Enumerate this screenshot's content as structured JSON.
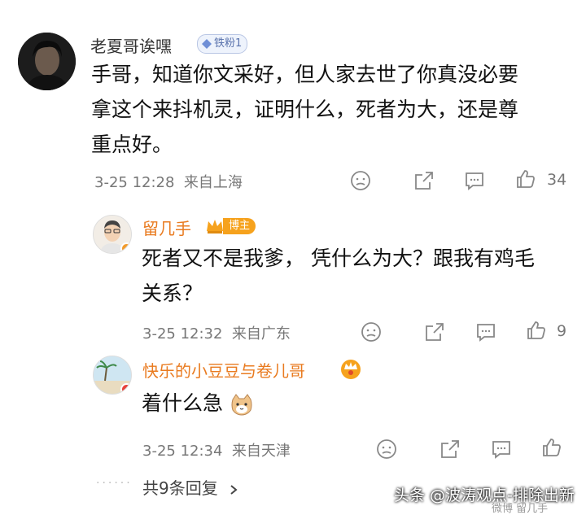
{
  "main_comment": {
    "username": "老夏哥诶嘿",
    "fan_badge": "铁粉1",
    "text_lines": [
      "手哥，知道你文采好，但人家去世了你真没必要",
      "拿这个来抖机灵，证明什么，死者为大，还是尊",
      "重点好。"
    ],
    "time": "3-25 12:28",
    "location": "来自上海",
    "like_count": "34"
  },
  "reply1": {
    "username": "留几手",
    "host_badge": "博主",
    "text_lines": [
      "死者又不是我爹， 凭什么为大？跟我有鸡毛",
      "关系？"
    ],
    "time": "3-25 12:32",
    "location": "来自广东",
    "like_count": "9"
  },
  "reply2": {
    "username": "快乐的小豆豆与卷儿哥",
    "text": "着什么急",
    "time": "3-25 12:34",
    "location": "来自天津"
  },
  "more_replies": "共9条回复",
  "watermark": "头条 @波涛观点-排除出新",
  "watermark_small": "微博 留几手",
  "icons": [
    "dislike-icon",
    "share-icon",
    "comment-icon",
    "like-icon",
    "chevron-right-icon",
    "cat-emoji-icon",
    "crown-icon"
  ]
}
